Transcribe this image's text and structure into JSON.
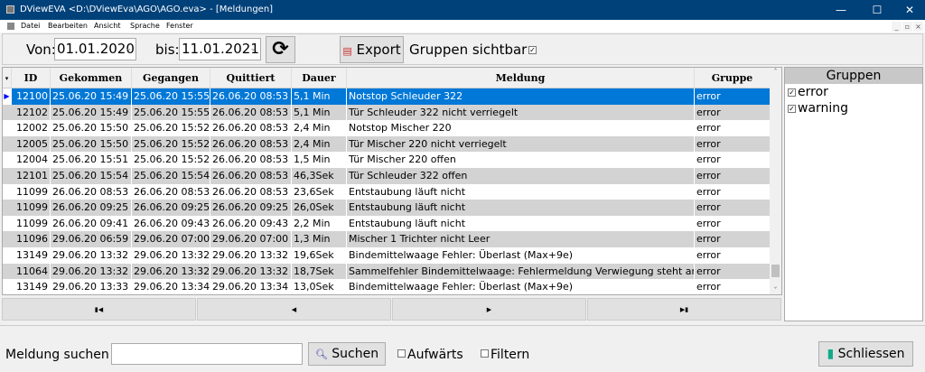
{
  "window": {
    "title": "DViewEVA <D:\\DViewEva\\AGO\\AGO.eva> - [Meldungen]",
    "minimize": "—",
    "maximize": "☐",
    "close": "✕"
  },
  "menu": [
    "Datei",
    "Bearbeiten",
    "Ansicht",
    "Sprache",
    "Fenster"
  ],
  "toolbar": {
    "von_label": "Von:",
    "von_value": "01.01.2020",
    "bis_label": "bis:",
    "bis_value": "11.01.2021",
    "export_label": "Export",
    "gruppen_sichtbar_label": "Gruppen sichtbar",
    "gruppen_sichtbar_checked": true
  },
  "table": {
    "columns": [
      "ID",
      "Gekommen",
      "Gegangen",
      "Quittiert",
      "Dauer",
      "Meldung",
      "Gruppe"
    ],
    "rows": [
      [
        "12100",
        "25.06.20 15:49",
        "25.06.20 15:55",
        "26.06.20 08:53",
        "5,1 Min",
        "Notstop Schleuder 322",
        "error"
      ],
      [
        "12102",
        "25.06.20 15:49",
        "25.06.20 15:55",
        "26.06.20 08:53",
        "5,1 Min",
        "Tür Schleuder 322 nicht verriegelt",
        "error"
      ],
      [
        "12002",
        "25.06.20 15:50",
        "25.06.20 15:52",
        "26.06.20 08:53",
        "2,4 Min",
        "Notstop Mischer 220",
        "error"
      ],
      [
        "12005",
        "25.06.20 15:50",
        "25.06.20 15:52",
        "26.06.20 08:53",
        "2,4 Min",
        "Tür Mischer 220 nicht verriegelt",
        "error"
      ],
      [
        "12004",
        "25.06.20 15:51",
        "25.06.20 15:52",
        "26.06.20 08:53",
        "1,5 Min",
        "Tür Mischer 220 offen",
        "error"
      ],
      [
        "12101",
        "25.06.20 15:54",
        "25.06.20 15:54",
        "26.06.20 08:53",
        "46,3Sek",
        "Tür Schleuder 322 offen",
        "error"
      ],
      [
        "11099",
        "26.06.20 08:53",
        "26.06.20 08:53",
        "26.06.20 08:53",
        "23,6Sek",
        "Entstaubung läuft nicht",
        "error"
      ],
      [
        "11099",
        "26.06.20 09:25",
        "26.06.20 09:25",
        "26.06.20 09:25",
        "26,0Sek",
        "Entstaubung läuft nicht",
        "error"
      ],
      [
        "11099",
        "26.06.20 09:41",
        "26.06.20 09:43",
        "26.06.20 09:43",
        "2,2 Min",
        "Entstaubung läuft nicht",
        "error"
      ],
      [
        "11096",
        "29.06.20 06:59",
        "29.06.20 07:00",
        "29.06.20 07:00",
        "1,3 Min",
        "Mischer 1 Trichter nicht Leer",
        "error"
      ],
      [
        "13149",
        "29.06.20 13:32",
        "29.06.20 13:32",
        "29.06.20 13:32",
        "19,6Sek",
        "Bindemittelwaage Fehler: Überlast (Max+9e)",
        "error"
      ],
      [
        "11064",
        "29.06.20 13:32",
        "29.06.20 13:32",
        "29.06.20 13:32",
        "18,7Sek",
        "Sammelfehler Bindemittelwaage: Fehlermeldung Verwiegung steht an",
        "error"
      ],
      [
        "13149",
        "29.06.20 13:33",
        "29.06.20 13:34",
        "29.06.20 13:34",
        "13,0Sek",
        "Bindemittelwaage Fehler: Überlast (Max+9e)",
        "error"
      ]
    ],
    "selected_row": 0
  },
  "nav": [
    "first",
    "previous",
    "next",
    "last"
  ],
  "groups": {
    "title": "Gruppen",
    "items": [
      {
        "label": "error",
        "checked": true
      },
      {
        "label": "warning",
        "checked": true
      }
    ]
  },
  "search": {
    "label": "Meldung suchen",
    "value": "",
    "button": "Suchen",
    "aufwaerts": "Aufwärts",
    "filtern": "Filtern"
  },
  "close_button": "Schliessen",
  "colors": {
    "titlebar": "#00417a",
    "selection": "#0078d7"
  }
}
